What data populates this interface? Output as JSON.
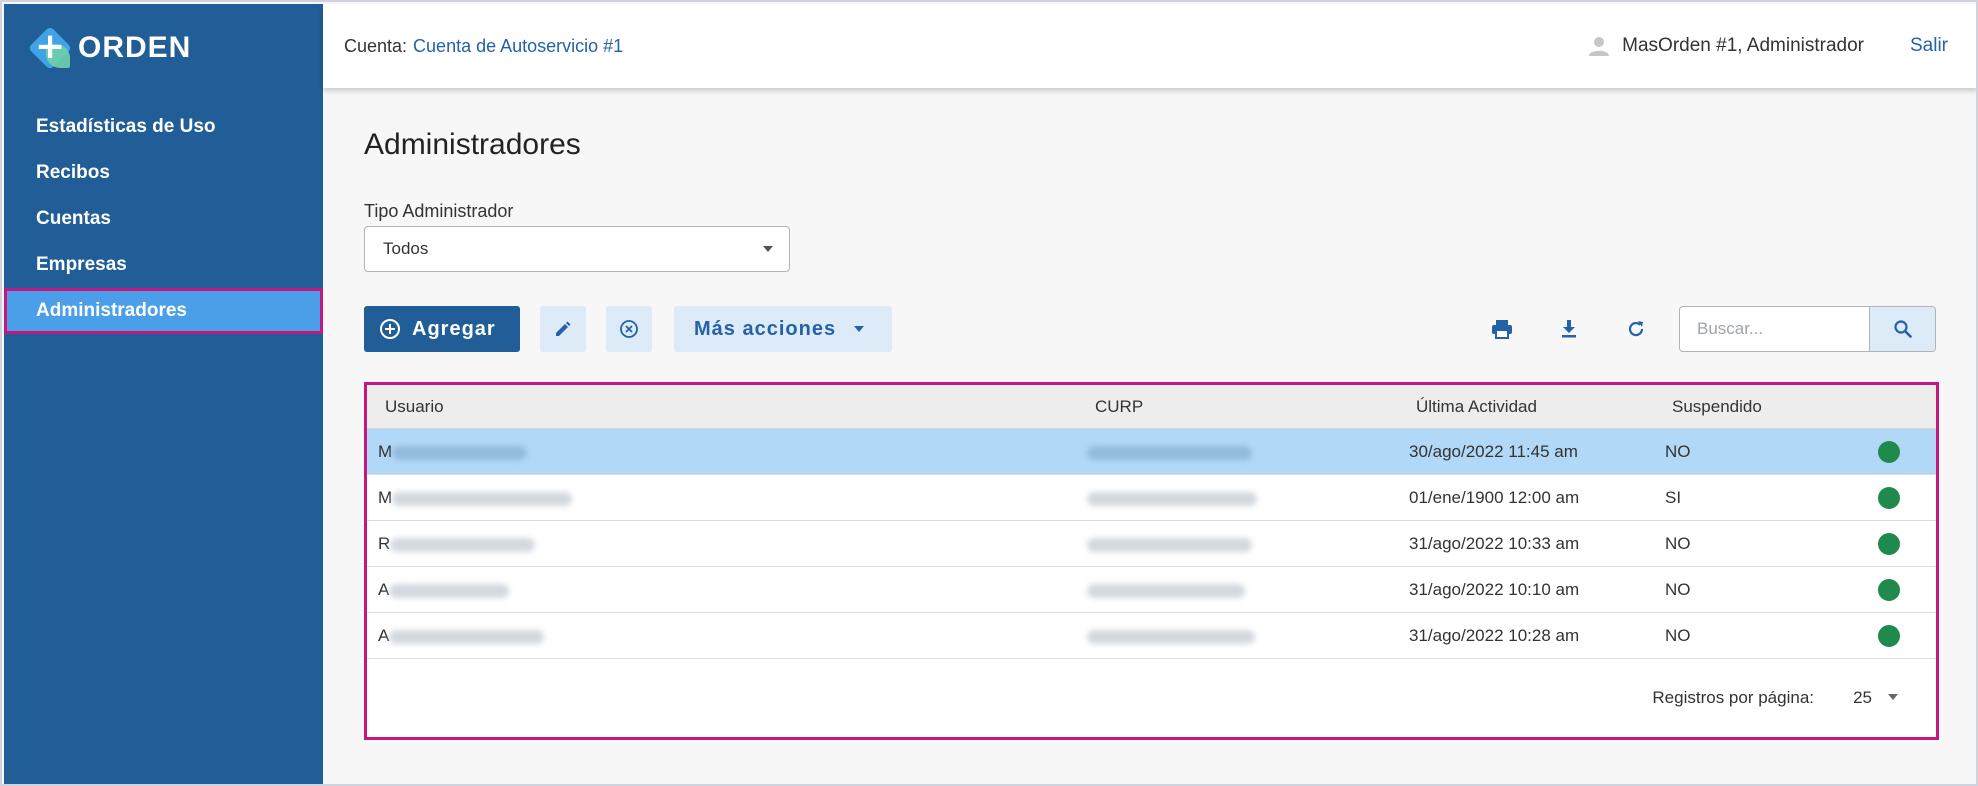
{
  "brand": {
    "name": "ORDEN"
  },
  "sidebar": {
    "items": [
      {
        "label": "Estadísticas de Uso"
      },
      {
        "label": "Recibos"
      },
      {
        "label": "Cuentas"
      },
      {
        "label": "Empresas"
      },
      {
        "label": "Administradores",
        "active": true
      }
    ]
  },
  "header": {
    "account_label": "Cuenta:",
    "account_value": "Cuenta de Autoservicio #1",
    "user": "MasOrden #1, Administrador",
    "logout": "Salir"
  },
  "page": {
    "title": "Administradores",
    "filter_label": "Tipo Administrador",
    "filter_value": "Todos"
  },
  "toolbar": {
    "add_label": "Agregar",
    "more_label": "Más acciones",
    "search_placeholder": "Buscar...",
    "icons": [
      "edit-icon",
      "cancel-icon",
      "print-icon",
      "download-icon",
      "refresh-icon",
      "search-icon"
    ]
  },
  "table": {
    "columns": [
      "Usuario",
      "CURP",
      "Última Actividad",
      "Suspendido"
    ],
    "rows": [
      {
        "usuario": "M",
        "actividad": "30/ago/2022 11:45 am",
        "suspendido": "NO",
        "selected": true
      },
      {
        "usuario": "M",
        "actividad": "01/ene/1900 12:00 am",
        "suspendido": "SI"
      },
      {
        "usuario": "R",
        "actividad": "31/ago/2022 10:33 am",
        "suspendido": "NO"
      },
      {
        "usuario": "A",
        "actividad": "31/ago/2022 10:10 am",
        "suspendido": "NO"
      },
      {
        "usuario": "A",
        "actividad": "31/ago/2022 10:28 am",
        "suspendido": "NO"
      }
    ],
    "status_color": "#1f8a4c",
    "per_page_label": "Registros por página:",
    "per_page_value": "25"
  },
  "colors": {
    "sidebar": "#215e97",
    "active_item": "#4a9fe8",
    "highlight_border": "#c2187f",
    "selected_row": "#b1d8f7",
    "link": "#2462a8"
  }
}
